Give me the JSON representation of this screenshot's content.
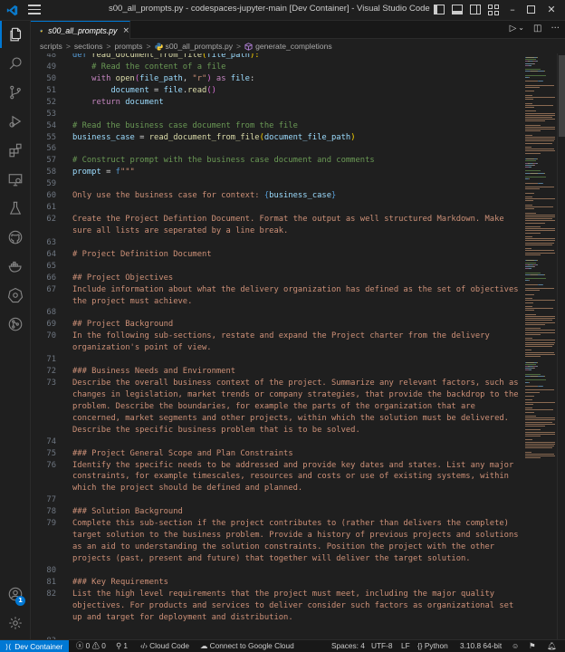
{
  "window": {
    "title": "s00_all_prompts.py - codespaces-jupyter-main [Dev Container] - Visual Studio Code"
  },
  "tab": {
    "label": "s00_all_prompts.py",
    "close": "×"
  },
  "breadcrumb": {
    "items": [
      "scripts",
      "sections",
      "prompts",
      "s00_all_prompts.py",
      "generate_completions"
    ],
    "separator": ">"
  },
  "editor": {
    "lines": [
      {
        "n": "48",
        "segs": [
          {
            "t": "def ",
            "c": "c-blue"
          },
          {
            "t": "read_document_from_file",
            "c": "c-fn"
          },
          {
            "t": "(",
            "c": "c-yel"
          },
          {
            "t": "file_path",
            "c": "c-var"
          },
          {
            "t": "):",
            "c": "c-yel"
          }
        ]
      },
      {
        "n": "49",
        "segs": [
          {
            "t": "    # Read the content of a file",
            "c": "c-cm"
          }
        ]
      },
      {
        "n": "50",
        "segs": [
          {
            "t": "    with ",
            "c": "c-kw"
          },
          {
            "t": "open",
            "c": "c-fn"
          },
          {
            "t": "(",
            "c": "c-br"
          },
          {
            "t": "file_path",
            "c": "c-var"
          },
          {
            "t": ", ",
            "c": "c-op"
          },
          {
            "t": "\"r\"",
            "c": "c-str"
          },
          {
            "t": ") ",
            "c": "c-br"
          },
          {
            "t": "as ",
            "c": "c-kw"
          },
          {
            "t": "file",
            "c": "c-var"
          },
          {
            "t": ":",
            "c": "c-op"
          }
        ]
      },
      {
        "n": "51",
        "segs": [
          {
            "t": "        document ",
            "c": "c-var"
          },
          {
            "t": "= ",
            "c": "c-op"
          },
          {
            "t": "file",
            "c": "c-var"
          },
          {
            "t": ".",
            "c": "c-op"
          },
          {
            "t": "read",
            "c": "c-fn"
          },
          {
            "t": "()",
            "c": "c-br"
          }
        ]
      },
      {
        "n": "52",
        "segs": [
          {
            "t": "    return ",
            "c": "c-kw"
          },
          {
            "t": "document",
            "c": "c-var"
          }
        ]
      },
      {
        "n": "53",
        "segs": []
      },
      {
        "n": "54",
        "segs": [
          {
            "t": "# Read the business case document from the file",
            "c": "c-cm"
          }
        ]
      },
      {
        "n": "55",
        "segs": [
          {
            "t": "business_case ",
            "c": "c-var"
          },
          {
            "t": "= ",
            "c": "c-op"
          },
          {
            "t": "read_document_from_file",
            "c": "c-fn"
          },
          {
            "t": "(",
            "c": "c-yel"
          },
          {
            "t": "document_file_path",
            "c": "c-var"
          },
          {
            "t": ")",
            "c": "c-yel"
          }
        ]
      },
      {
        "n": "56",
        "segs": []
      },
      {
        "n": "57",
        "segs": [
          {
            "t": "# Construct prompt with the business case document and comments",
            "c": "c-cm"
          }
        ]
      },
      {
        "n": "58",
        "segs": [
          {
            "t": "prompt ",
            "c": "c-var"
          },
          {
            "t": "= ",
            "c": "c-op"
          },
          {
            "t": "f",
            "c": "c-blue"
          },
          {
            "t": "\"\"\"",
            "c": "c-str"
          }
        ]
      },
      {
        "n": "59",
        "segs": []
      },
      {
        "n": "60",
        "segs": [
          {
            "t": "Only use the business case for context: ",
            "c": "c-str"
          },
          {
            "t": "{",
            "c": "c-blue"
          },
          {
            "t": "business_case",
            "c": "c-var"
          },
          {
            "t": "}",
            "c": "c-blue"
          }
        ]
      },
      {
        "n": "61",
        "segs": []
      },
      {
        "n": "62",
        "segs": [
          {
            "t": "Create the Project Defintion Document. Format the output as well structured Markdown. Make",
            "c": "c-str"
          }
        ]
      },
      {
        "n": "",
        "segs": [
          {
            "t": "sure all lists are seperated by a line break.",
            "c": "c-str"
          }
        ]
      },
      {
        "n": "63",
        "segs": []
      },
      {
        "n": "64",
        "segs": [
          {
            "t": "# Project Definition Document",
            "c": "c-str"
          }
        ]
      },
      {
        "n": "65",
        "segs": []
      },
      {
        "n": "66",
        "segs": [
          {
            "t": "## Project Objectives",
            "c": "c-str"
          }
        ]
      },
      {
        "n": "67",
        "segs": [
          {
            "t": "Include information about what the delivery organization has defined as the set of objectives",
            "c": "c-str"
          }
        ]
      },
      {
        "n": "",
        "segs": [
          {
            "t": "the project must achieve.",
            "c": "c-str"
          }
        ]
      },
      {
        "n": "68",
        "segs": []
      },
      {
        "n": "69",
        "segs": [
          {
            "t": "## Project Background",
            "c": "c-str"
          }
        ]
      },
      {
        "n": "70",
        "segs": [
          {
            "t": "In the following sub-sections, restate and expand the Project charter from the delivery",
            "c": "c-str"
          }
        ]
      },
      {
        "n": "",
        "segs": [
          {
            "t": "organization's point of view.",
            "c": "c-str"
          }
        ]
      },
      {
        "n": "71",
        "segs": []
      },
      {
        "n": "72",
        "segs": [
          {
            "t": "### Business Needs and Environment",
            "c": "c-str"
          }
        ]
      },
      {
        "n": "73",
        "segs": [
          {
            "t": "Describe the overall business context of the project. Summarize any relevant factors, such as",
            "c": "c-str"
          }
        ]
      },
      {
        "n": "",
        "segs": [
          {
            "t": "changes in legislation, market trends or company strategies, that provide the backdrop to the",
            "c": "c-str"
          }
        ]
      },
      {
        "n": "",
        "segs": [
          {
            "t": "problem. Describe the boundaries, for example the parts of the organization that are",
            "c": "c-str"
          }
        ]
      },
      {
        "n": "",
        "segs": [
          {
            "t": "concerned, market segments and other projects, within which the solution must be delivered.",
            "c": "c-str"
          }
        ]
      },
      {
        "n": "",
        "segs": [
          {
            "t": "Describe the specific business problem that is to be solved.",
            "c": "c-str"
          }
        ]
      },
      {
        "n": "74",
        "segs": []
      },
      {
        "n": "75",
        "segs": [
          {
            "t": "### Project General Scope and Plan Constraints",
            "c": "c-str"
          }
        ]
      },
      {
        "n": "76",
        "segs": [
          {
            "t": "Identify the specific needs to be addressed and provide key dates and states. List any major",
            "c": "c-str"
          }
        ]
      },
      {
        "n": "",
        "segs": [
          {
            "t": "constraints, for example timescales, resources and costs or use of existing systems, within",
            "c": "c-str"
          }
        ]
      },
      {
        "n": "",
        "segs": [
          {
            "t": "which the project should be defined and planned.",
            "c": "c-str"
          }
        ]
      },
      {
        "n": "77",
        "segs": []
      },
      {
        "n": "78",
        "segs": [
          {
            "t": "### Solution Background",
            "c": "c-str"
          }
        ]
      },
      {
        "n": "79",
        "segs": [
          {
            "t": "Complete this sub-section if the project contributes to (rather than delivers the complete)",
            "c": "c-str"
          }
        ]
      },
      {
        "n": "",
        "segs": [
          {
            "t": "target solution to the business problem. Provide a history of previous projects and solutions",
            "c": "c-str"
          }
        ]
      },
      {
        "n": "",
        "segs": [
          {
            "t": "as an aid to understanding the solution constraints. Position the project with the other",
            "c": "c-str"
          }
        ]
      },
      {
        "n": "",
        "segs": [
          {
            "t": "projects (past, present and future) that together will deliver the target solution.",
            "c": "c-str"
          }
        ]
      },
      {
        "n": "80",
        "segs": []
      },
      {
        "n": "81",
        "segs": [
          {
            "t": "### Key Requirements",
            "c": "c-str"
          }
        ]
      },
      {
        "n": "82",
        "segs": [
          {
            "t": "List the high level requirements that the project must meet, including the major quality",
            "c": "c-str"
          }
        ]
      },
      {
        "n": "",
        "segs": [
          {
            "t": "objectives. For products and services to deliver consider such factors as organizational set",
            "c": "c-str"
          }
        ]
      },
      {
        "n": "",
        "segs": [
          {
            "t": "up and target for deployment and distribution.",
            "c": "c-str"
          }
        ]
      },
      {
        "n": "",
        "segs": []
      },
      {
        "n": "83",
        "segs": []
      }
    ]
  },
  "statusbar": {
    "remote": "Dev Container",
    "problems": "0",
    "warnings": "0",
    "ports": "1",
    "cloud_code": "Cloud Code",
    "google_cloud": "Connect to Google Cloud",
    "spaces": "Spaces: 4",
    "encoding": "UTF-8",
    "eol": "LF",
    "language": "Python",
    "interpreter": "3.10.8 64-bit"
  },
  "accounts_badge": "1",
  "colors": {
    "accent": "#0078d4",
    "string": "#ce9178",
    "comment": "#6a9955",
    "keyword": "#c586c0",
    "function": "#dcdcaa",
    "variable": "#9cdcfe"
  }
}
